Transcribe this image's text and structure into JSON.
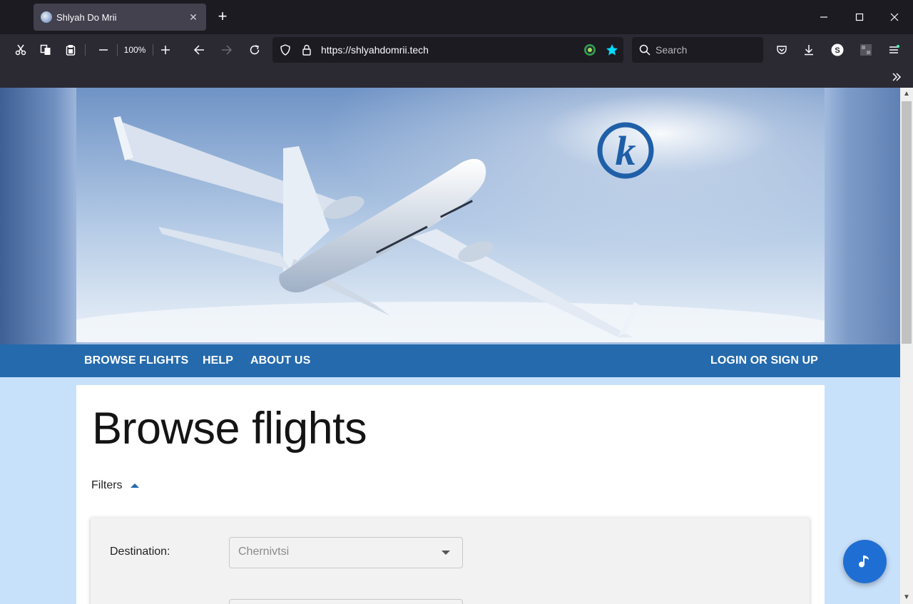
{
  "browser": {
    "tab_title": "Shlyah Do Mrii",
    "zoom": "100%",
    "url": "https://shlyahdomrii.tech",
    "search_placeholder": "Search"
  },
  "site": {
    "nav_left": [
      "BROWSE FLIGHTS",
      "HELP",
      "ABOUT US"
    ],
    "nav_right": "LOGIN OR SIGN UP",
    "page_title": "Browse flights",
    "filters_label": "Filters",
    "destination_label": "Destination:",
    "destination_value": "Chernivtsi"
  },
  "colors": {
    "nav_bar": "#256aad",
    "page_bg": "#c8e1fb",
    "fab": "#1f6ed4"
  }
}
